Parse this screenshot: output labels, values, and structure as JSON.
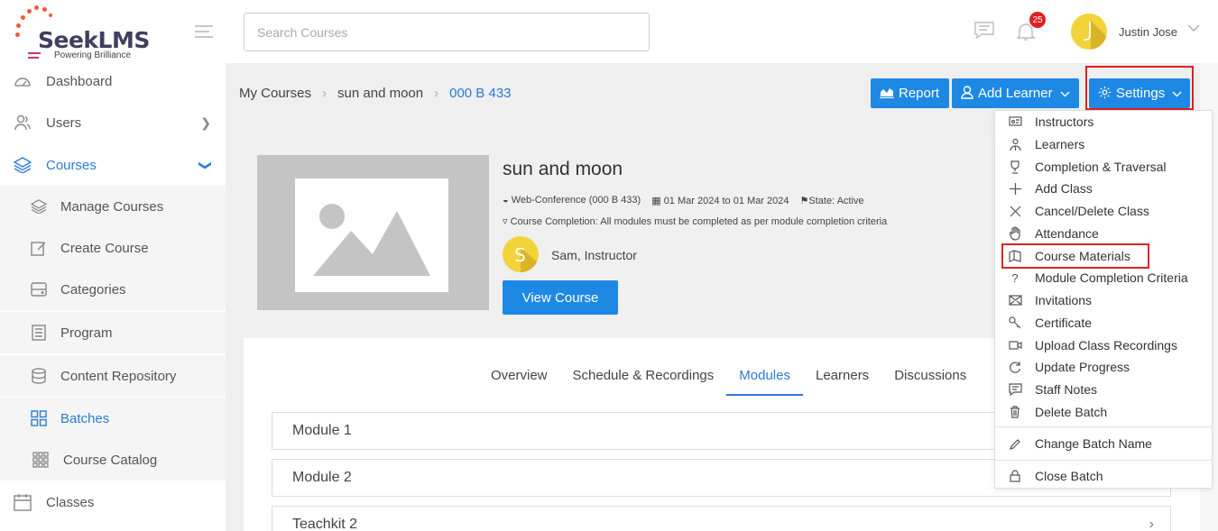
{
  "brand": {
    "name": "SeekLMS",
    "tagline": "Powering Brilliance"
  },
  "search": {
    "placeholder": "Search Courses"
  },
  "header": {
    "notification_count": "25",
    "user_name": "Justin Jose"
  },
  "sidebar": {
    "items": [
      {
        "label": "Dashboard",
        "icon": "gauge-icon"
      },
      {
        "label": "Users",
        "icon": "users-icon"
      },
      {
        "label": "Courses",
        "icon": "layers-icon"
      },
      {
        "label": "Manage Courses",
        "icon": "layers-icon"
      },
      {
        "label": "Create Course",
        "icon": "edit-icon"
      },
      {
        "label": "Categories",
        "icon": "drive-icon"
      },
      {
        "label": "Program",
        "icon": "list-icon"
      },
      {
        "label": "Content Repository",
        "icon": "database-icon"
      },
      {
        "label": "Batches",
        "icon": "grid-icon"
      },
      {
        "label": "Course Catalog",
        "icon": "apps-icon"
      },
      {
        "label": "Classes",
        "icon": "calendar-icon"
      }
    ]
  },
  "breadcrumb": {
    "items": [
      "My Courses",
      "sun and moon",
      "000 B 433"
    ]
  },
  "actions": {
    "report": "Report",
    "add_learner": "Add Learner",
    "settings": "Settings"
  },
  "course": {
    "title": "sun and moon",
    "mode": "Web-Conference (000 B 433)",
    "dates": "01 Mar 2024 to 01 Mar 2024",
    "state": "State: Active",
    "completion": "Course Completion: All modules must be completed as per module completion criteria",
    "instructor": "Sam, Instructor",
    "instructor_initial": "S",
    "view_button": "View Course"
  },
  "tabs": [
    "Overview",
    "Schedule & Recordings",
    "Modules",
    "Learners",
    "Discussions"
  ],
  "active_tab": "Modules",
  "modules": [
    "Module 1",
    "Module 2",
    "Teachkit 2"
  ],
  "settings_menu": {
    "items": [
      {
        "label": "Instructors",
        "icon": "instructor-icon"
      },
      {
        "label": "Learners",
        "icon": "learners-icon"
      },
      {
        "label": "Completion & Traversal",
        "icon": "trophy-icon"
      },
      {
        "label": "Add Class",
        "icon": "plus-icon"
      },
      {
        "label": "Cancel/Delete Class",
        "icon": "close-icon"
      },
      {
        "label": "Attendance",
        "icon": "hand-icon"
      },
      {
        "label": "Course Materials",
        "icon": "book-icon"
      },
      {
        "label": "Module Completion Criteria",
        "icon": "question-icon"
      },
      {
        "label": "Invitations",
        "icon": "envelope-icon"
      },
      {
        "label": "Certificate",
        "icon": "certificate-icon"
      },
      {
        "label": "Upload Class Recordings",
        "icon": "video-icon"
      },
      {
        "label": "Update Progress",
        "icon": "refresh-icon"
      },
      {
        "label": "Staff Notes",
        "icon": "note-icon"
      },
      {
        "label": "Delete Batch",
        "icon": "trash-icon"
      },
      {
        "label": "Change Batch Name",
        "icon": "pencil-icon"
      },
      {
        "label": "Close Batch",
        "icon": "lock-icon"
      }
    ]
  },
  "colors": {
    "primary": "#1e88e5",
    "active_text": "#2b7bd6",
    "highlight": "#e02020",
    "avatar": "#f3d33a"
  }
}
